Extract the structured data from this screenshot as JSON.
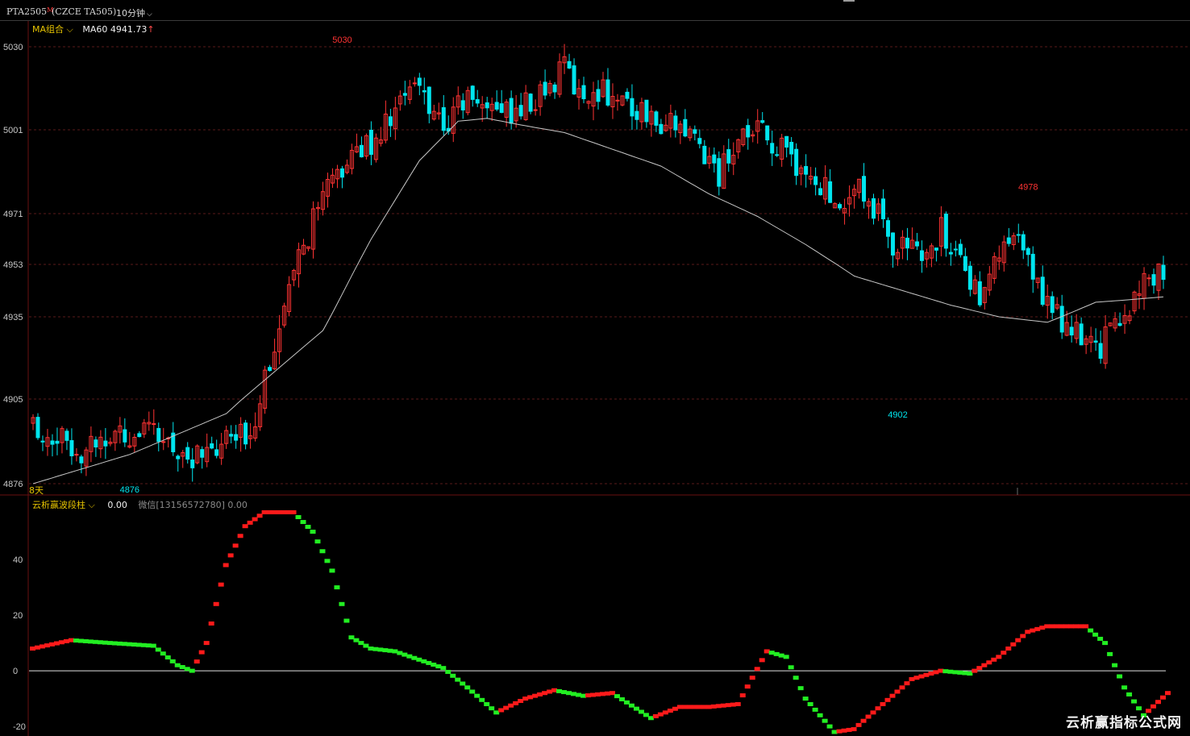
{
  "header": {
    "symbol": "PTA2505",
    "flag": "M",
    "code": "(CZCE TA505)",
    "period": "10分钟"
  },
  "ma_legend": {
    "name": "MA组合",
    "value": "MA60 4941.73",
    "arrow": "↑"
  },
  "days_label": "8天",
  "indicator_legend": {
    "name": "云析赢波段柱",
    "value": "0.00",
    "note": "微信[13156572780] 0.00"
  },
  "watermark": "云析赢指标公式网",
  "colors": {
    "up": "#ff3333",
    "down": "#00e5ee",
    "ma": "#c8c8c8",
    "grid": "#5a1a1a",
    "ind_up": "#ff1a1a",
    "ind_down": "#22ee22"
  },
  "chart_data": [
    {
      "type": "candlestick",
      "y_ticks": [
        4876,
        4905,
        4935,
        4953,
        4971,
        5001,
        5030
      ],
      "ylim": [
        4876,
        5030
      ],
      "bar_count": 235,
      "high_label": "5030",
      "low_label": "4876",
      "local_high_label": "4978",
      "local_low_label": "4902",
      "close_path": [
        [
          0,
          4896
        ],
        [
          10,
          4888
        ],
        [
          18,
          4894
        ],
        [
          25,
          4892
        ],
        [
          32,
          4886
        ],
        [
          36,
          4884
        ],
        [
          40,
          4890
        ],
        [
          45,
          4893
        ],
        [
          48,
          4915
        ],
        [
          52,
          4935
        ],
        [
          56,
          4960
        ],
        [
          60,
          4976
        ],
        [
          65,
          4990
        ],
        [
          70,
          4997
        ],
        [
          76,
          5010
        ],
        [
          80,
          5016
        ],
        [
          85,
          5002
        ],
        [
          90,
          5012
        ],
        [
          95,
          5010
        ],
        [
          100,
          5006
        ],
        [
          105,
          5014
        ],
        [
          110,
          5022
        ],
        [
          114,
          5012
        ],
        [
          118,
          5016
        ],
        [
          122,
          5010
        ],
        [
          126,
          5008
        ],
        [
          130,
          5004
        ],
        [
          134,
          5002
        ],
        [
          138,
          4995
        ],
        [
          142,
          4985
        ],
        [
          146,
          4998
        ],
        [
          150,
          5000
        ],
        [
          156,
          4992
        ],
        [
          162,
          4982
        ],
        [
          168,
          4976
        ],
        [
          172,
          4980
        ],
        [
          178,
          4960
        ],
        [
          184,
          4955
        ],
        [
          188,
          4965
        ],
        [
          192,
          4952
        ],
        [
          196,
          4944
        ],
        [
          200,
          4957
        ],
        [
          204,
          4960
        ],
        [
          208,
          4946
        ],
        [
          212,
          4936
        ],
        [
          216,
          4928
        ],
        [
          220,
          4923
        ],
        [
          224,
          4930
        ],
        [
          228,
          4942
        ],
        [
          232,
          4950
        ],
        [
          235,
          4948
        ]
      ],
      "ma_path": [
        [
          0,
          4876
        ],
        [
          20,
          4886
        ],
        [
          40,
          4900
        ],
        [
          60,
          4930
        ],
        [
          70,
          4962
        ],
        [
          80,
          4990
        ],
        [
          88,
          5004
        ],
        [
          94,
          5005
        ],
        [
          100,
          5003
        ],
        [
          110,
          5000
        ],
        [
          120,
          4994
        ],
        [
          130,
          4988
        ],
        [
          140,
          4978
        ],
        [
          150,
          4970
        ],
        [
          160,
          4960
        ],
        [
          170,
          4949
        ],
        [
          180,
          4944
        ],
        [
          190,
          4939
        ],
        [
          200,
          4935
        ],
        [
          210,
          4933
        ],
        [
          220,
          4940
        ],
        [
          228,
          4941
        ],
        [
          235,
          4942
        ]
      ]
    },
    {
      "type": "bar",
      "name": "云析赢波段柱",
      "y_ticks": [
        -20,
        0,
        20,
        40
      ],
      "ylim": [
        -22,
        58
      ],
      "wave_path": [
        [
          0,
          8
        ],
        [
          8,
          11
        ],
        [
          16,
          10
        ],
        [
          25,
          9
        ],
        [
          30,
          2
        ],
        [
          33,
          0
        ],
        [
          36,
          10
        ],
        [
          40,
          38
        ],
        [
          44,
          52
        ],
        [
          48,
          57
        ],
        [
          54,
          57
        ],
        [
          58,
          50
        ],
        [
          62,
          36
        ],
        [
          66,
          12
        ],
        [
          70,
          8
        ],
        [
          75,
          7
        ],
        [
          85,
          1
        ],
        [
          90,
          -6
        ],
        [
          96,
          -15
        ],
        [
          102,
          -10
        ],
        [
          108,
          -7
        ],
        [
          114,
          -9
        ],
        [
          120,
          -8
        ],
        [
          128,
          -17
        ],
        [
          134,
          -13
        ],
        [
          140,
          -13
        ],
        [
          146,
          -12
        ],
        [
          152,
          7
        ],
        [
          156,
          5
        ],
        [
          160,
          -10
        ],
        [
          166,
          -22
        ],
        [
          170,
          -21
        ],
        [
          176,
          -12
        ],
        [
          182,
          -3
        ],
        [
          188,
          0
        ],
        [
          194,
          -1
        ],
        [
          200,
          5
        ],
        [
          206,
          14
        ],
        [
          210,
          16
        ],
        [
          218,
          16
        ],
        [
          222,
          10
        ],
        [
          226,
          -6
        ],
        [
          230,
          -16
        ],
        [
          235,
          -8
        ]
      ]
    }
  ]
}
